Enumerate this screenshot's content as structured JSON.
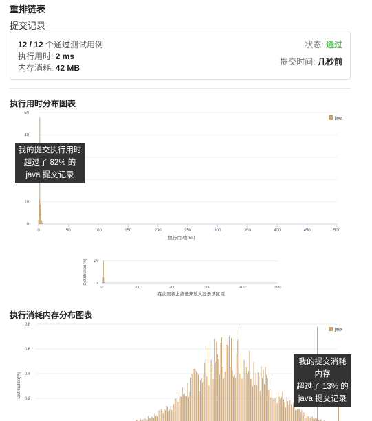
{
  "page": {
    "title": "重排链表",
    "subtitle": "提交记录"
  },
  "submission": {
    "tests": "12 / 12",
    "tests_suffix": "个通过测试用例",
    "runtime_label": "执行用时:",
    "runtime_value": "2 ms",
    "memory_label": "内存消耗:",
    "memory_value": "42 MB",
    "status_label": "状态:",
    "status_value": "通过",
    "time_label": "提交时间:",
    "time_value": "几秒前",
    "colors": {
      "status": "#5cb85c"
    }
  },
  "runtime_section": {
    "heading": "执行用时分布图表",
    "tooltip": [
      "我的提交执行用时",
      "超过了 82% 的",
      "java 提交记录"
    ],
    "nav_hint": "在此图表上拖选来放大显示该区域"
  },
  "memory_section": {
    "heading": "执行消耗内存分布图表",
    "tooltip": [
      "我的提交消耗",
      "内存",
      "超过了 13% 的",
      "java 提交记录"
    ]
  },
  "chart_data": [
    {
      "type": "bar",
      "title": "",
      "xlabel": "执行用时(ms)",
      "ylabel": "",
      "xlim": [
        0,
        500
      ],
      "ylim": [
        0,
        50
      ],
      "x_ticks": [
        "0",
        "50",
        "100",
        "150",
        "200",
        "250",
        "300",
        "350",
        "400",
        "450",
        "500"
      ],
      "y_ticks": [
        "0",
        "10",
        "20",
        "30",
        "40",
        "50"
      ],
      "series": [
        {
          "name": "java",
          "color": "#c8a06b",
          "x": [
            0,
            1,
            2,
            3,
            4,
            5,
            6,
            7
          ],
          "values": [
            2,
            11,
            48,
            9,
            3,
            1.5,
            0.8,
            0.4
          ]
        }
      ],
      "legend": "top-right",
      "grid": true
    },
    {
      "type": "bar",
      "title": "",
      "xlabel": "在此图表上拖选来放大显示该区域",
      "ylabel": "Distribution(%)",
      "xlim": [
        0,
        500
      ],
      "ylim": [
        0,
        50
      ],
      "x_ticks": [
        "0",
        "100",
        "200",
        "300",
        "400",
        "500"
      ],
      "y_ticks": [
        "0",
        "45"
      ],
      "series": [
        {
          "name": "java",
          "color": "#c8a06b",
          "x": [
            0,
            1,
            2,
            3,
            4
          ],
          "values": [
            2,
            12,
            45,
            10,
            3
          ]
        }
      ]
    },
    {
      "type": "bar",
      "title": "",
      "xlabel": "",
      "ylabel": "Distribution(%)",
      "ylim": [
        0,
        0.8
      ],
      "y_ticks": [
        "0.2",
        "0.4",
        "0.6",
        "0.8"
      ],
      "series": [
        {
          "name": "java",
          "color": "#c8a06b"
        }
      ],
      "legend": "top-right",
      "grid": true
    }
  ]
}
